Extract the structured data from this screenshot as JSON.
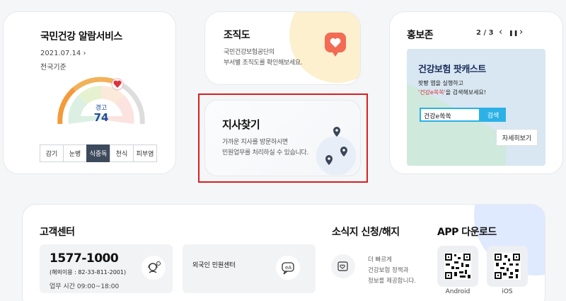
{
  "health": {
    "title": "국민건강 알람서비스",
    "date": "2021.07.14",
    "date_arrow": "›",
    "region": "전국기준",
    "gauge_label": "경고",
    "gauge_value": "74",
    "tabs": [
      "감기",
      "눈병",
      "식중독",
      "천식",
      "피부염"
    ],
    "active_tab": "식중독"
  },
  "org": {
    "title": "조직도",
    "desc_line1": "국민건강보험공단의",
    "desc_line2": "부서별 조직도를 확인해보세요."
  },
  "branch": {
    "title": "지사찾기",
    "desc_line1": "가까운 지사를 방문하시면",
    "desc_line2": "민원업무를 처리하실 수 있습니다."
  },
  "pr": {
    "title": "홍보존",
    "pager": "2 / 3",
    "prev": "‹",
    "pause": "❚❚",
    "next": "›",
    "banner_title": "건강보험 팟캐스트",
    "banner_line1": "팟빵 앱을 실행하고",
    "banner_highlight": "'건강e쏙쏙'",
    "banner_line2_rest": "을 검색해보세요!",
    "search_value": "건강e쏙쏙",
    "search_button": "검색",
    "more_button": "자세히보기"
  },
  "customer": {
    "title": "고객센터",
    "phone": "1577-1000",
    "abroad": "(해외이용 : 82-33-811-2001)",
    "hours": "업무 시간 09:00~18:00",
    "foreign_center": "외국인 민원센터"
  },
  "newsletter": {
    "title": "소식지 신청/해지",
    "line1": "더 빠르게",
    "line2": "건강보험 정책과",
    "line3": "정보를 제공합니다."
  },
  "app": {
    "title": "APP 다운로드",
    "android": "Android",
    "ios": "iOS"
  }
}
